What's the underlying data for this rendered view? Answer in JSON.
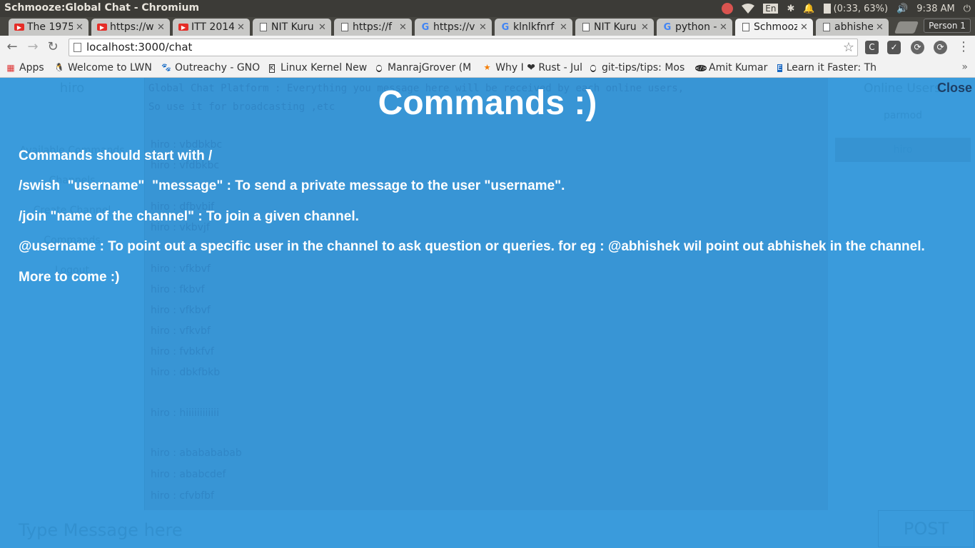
{
  "window": {
    "title": "Schmooze:Global Chat - Chromium"
  },
  "tray": {
    "lang": "En",
    "battery": "(0:33, 63%)",
    "time": "9:38 AM"
  },
  "tabs": [
    {
      "title": "The 1975",
      "favicon": "youtube-icon",
      "active": false
    },
    {
      "title": "https://w",
      "favicon": "youtube-icon",
      "active": false
    },
    {
      "title": "ITT 2014",
      "favicon": "youtube-icon",
      "active": false
    },
    {
      "title": "NIT Kuru",
      "favicon": "page-icon",
      "active": false
    },
    {
      "title": "https://f",
      "favicon": "page-icon",
      "active": false
    },
    {
      "title": "https://v",
      "favicon": "google-icon",
      "active": false
    },
    {
      "title": "klnlkfnrf",
      "favicon": "google-icon",
      "active": false
    },
    {
      "title": "NIT Kuru",
      "favicon": "page-icon",
      "active": false
    },
    {
      "title": "python -",
      "favicon": "google-icon",
      "active": false
    },
    {
      "title": "Schmooz",
      "favicon": "page-icon",
      "active": true
    },
    {
      "title": "abhishel",
      "favicon": "page-icon",
      "active": false
    }
  ],
  "profile": {
    "label": "Person 1"
  },
  "toolbar": {
    "url": "localhost:3000/chat"
  },
  "bookmarks": [
    {
      "label": "Apps",
      "icon": "apps-grid-icon"
    },
    {
      "label": "Welcome to LWN",
      "icon": "penguin-icon"
    },
    {
      "label": "Outreachy - GNO",
      "icon": "gnome-icon"
    },
    {
      "label": "Linux Kernel New",
      "icon": "kernel-icon"
    },
    {
      "label": "ManrajGrover (M",
      "icon": "github-icon"
    },
    {
      "label": "Why I ❤ Rust - Jul",
      "icon": "star-icon"
    },
    {
      "label": "git-tips/tips: Mos",
      "icon": "github-icon"
    },
    {
      "label": "Amit Kumar",
      "icon": "code-icon"
    },
    {
      "label": "Learn it Faster: Th",
      "icon": "book-icon"
    }
  ],
  "chat": {
    "sidebar_user": "hiro",
    "sidebar_nav": [
      "Available Commands",
      "Channels",
      "Create Channel",
      "Commands",
      "Logout"
    ],
    "header_line1": "Global Chat Platform : Everything you message here will be received by each online users,",
    "header_line2": "So use it for broadcasting ,etc",
    "messages": [
      {
        "user": "hiro",
        "text": "vbdbkbc"
      },
      {
        "user": "hiro",
        "text": "vfdbkbc"
      },
      {
        "user": "hiro",
        "text": "dfbvbjf"
      },
      {
        "user": "hiro",
        "text": "vkbvjf"
      },
      {
        "user": "hiro",
        "text": "vfkbvf"
      },
      {
        "user": "hiro",
        "text": "fkbvf"
      },
      {
        "user": "hiro",
        "text": "vfkbvf"
      },
      {
        "user": "hiro",
        "text": "vfkvbf"
      },
      {
        "user": "hiro",
        "text": "fvbkfvf"
      },
      {
        "user": "hiro",
        "text": "dbkfbkb"
      },
      {
        "user": "hiro",
        "text": "hiiiiiiiiiiii"
      },
      {
        "user": "hiro",
        "text": "ababababab"
      },
      {
        "user": "hiro",
        "text": "ababcdef"
      },
      {
        "user": "hiro",
        "text": "cfvbfbf"
      }
    ],
    "online_heading": "Online Users",
    "online_users": [
      "parmod",
      "hiro"
    ],
    "input_placeholder": "Type Message here",
    "post_label": "POST"
  },
  "modal": {
    "title": "Commands :)",
    "close_label": "Close",
    "lines": [
      "Commands should start with /",
      "/swish  \"username\"  \"message\" : To send a private message to the user \"username\".",
      "/join \"name of the channel\" : To join a given channel.",
      "@username : To point out a specific user in the channel to ask question or queries. for eg : @abhishek wil point out abhishek in the channel.",
      "More to come :)"
    ]
  },
  "colors": {
    "overlay": "#3a9bdc",
    "close_text": "#1d3f66",
    "text": "#ffffff"
  }
}
